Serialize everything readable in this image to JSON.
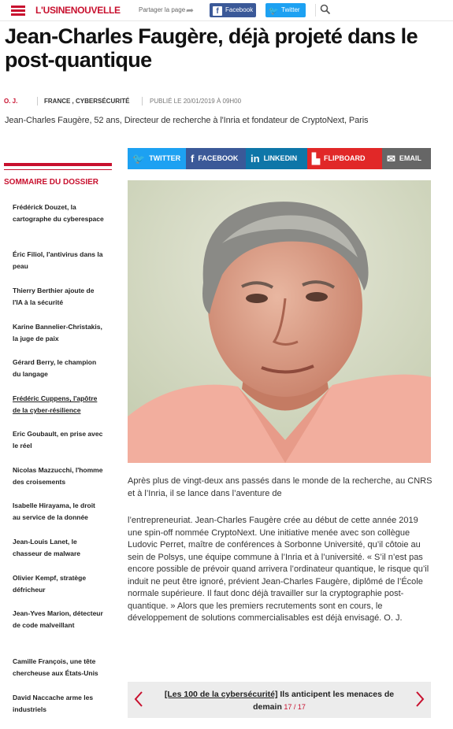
{
  "header": {
    "logo_part1": "L'USINE",
    "logo_part2": "NOUVELLE",
    "share_label": "Partager la page",
    "facebook_label": "Facebook",
    "twitter_label": "Twitter"
  },
  "article": {
    "title": "Jean-Charles Faugère, déjà projeté dans le post-quantique",
    "author": "O. J.",
    "categories": "FRANCE , CYBERSÉCURITÉ",
    "published": "PUBLIÉ LE 20/01/2019 À 09H00",
    "subtitle": "Jean-Charles Faugère, 52 ans, Directeur de recherche à l'Inria et fondateur de CryptoNext, Paris",
    "paragraph1": "Après plus de vingt-deux ans passés dans le monde de la recherche, au CNRS et à l’Inria, il se lance dans l’aventure de",
    "paragraph2": "l’entrepreneuriat. Jean-Charles Faugère crée au début de cette année 2019 une spin-off nommée CryptoNext. Une initiative menée avec son collègue Ludovic Perret, maître de conférences à Sorbonne Université, qu’il côtoie au sein de Polsys, une équipe commune à l’Inria et à l’université. « S’il n’est pas encore possible de prévoir quand arrivera l’ordinateur quantique, le risque qu’il induit ne peut être ignoré, prévient Jean-Charles Faugère, diplômé de l’École normale supérieure. Il faut donc déjà travailler sur la cryptographie post-quantique. » Alors que les premiers recrutements sont en cours, le développement de solutions commercialisables est déjà envisagé. O. J."
  },
  "share_bar": {
    "twitter": "TWITTER",
    "facebook": "FACEBOOK",
    "linkedin": "LINKEDIN",
    "flipboard": "FLIPBOARD",
    "email": "EMAIL"
  },
  "sidebar": {
    "title": "SOMMAIRE DU DOSSIER",
    "items": [
      {
        "label": "Frédérick Douzet, la cartographe du cyberespace"
      },
      {
        "label": "Éric Filiol, l'antivirus dans la peau"
      },
      {
        "label": "Thierry Berthier ajoute de l'IA à la sécurité"
      },
      {
        "label": "Karine Bannelier-Christakis, la juge de paix"
      },
      {
        "label": "Gérard Berry, le champion du langage"
      },
      {
        "label": "Frédéric Cuppens, l'apôtre de la cyber-résilience"
      },
      {
        "label": "Eric Goubault, en prise avec le réel"
      },
      {
        "label": "Nicolas Mazzucchi, l'homme des croisements"
      },
      {
        "label": "Isabelle Hirayama, le droit au service de la donnée"
      },
      {
        "label": "Jean-Louis Lanet, le chasseur de malware"
      },
      {
        "label": "Olivier Kempf, stratège défricheur"
      },
      {
        "label": "Jean-Yves Marion, détecteur de code malveillant"
      },
      {
        "label": "Camille François, une tête chercheuse aux États-Unis"
      },
      {
        "label": "David Naccache arme les industriels"
      }
    ]
  },
  "bottom_nav": {
    "dossier": "[Les 100 de la cybersécurité]",
    "text_a": " Ils anticipent les menaces de",
    "text_b": "demain",
    "page": " 17 / 17"
  },
  "colors": {
    "brand_red": "#c8102e",
    "facebook": "#3b5998",
    "twitter": "#1da1f2",
    "linkedin": "#0e76a8",
    "flipboard": "#e12828",
    "email": "#666666"
  }
}
